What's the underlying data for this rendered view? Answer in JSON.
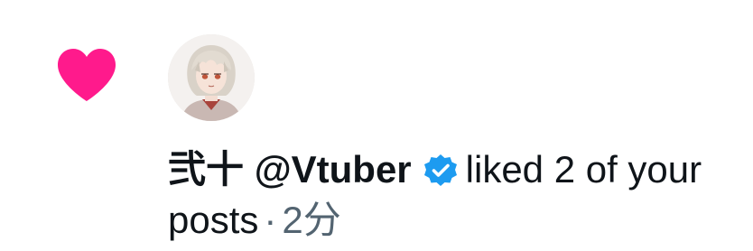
{
  "notification": {
    "type_icon": "heart-icon",
    "user": {
      "display_name": "弐十",
      "handle": "@Vtuber",
      "verified_icon": "verified-badge-icon",
      "avatar": "avatar-anime-character"
    },
    "action_line1": "liked 2 of your",
    "action_line2": "posts",
    "separator": "·",
    "time": "2分"
  },
  "colors": {
    "heart": "#ff1a8c",
    "verified": "#1d9bf0",
    "text_primary": "#0f1419",
    "text_secondary": "#536471"
  }
}
